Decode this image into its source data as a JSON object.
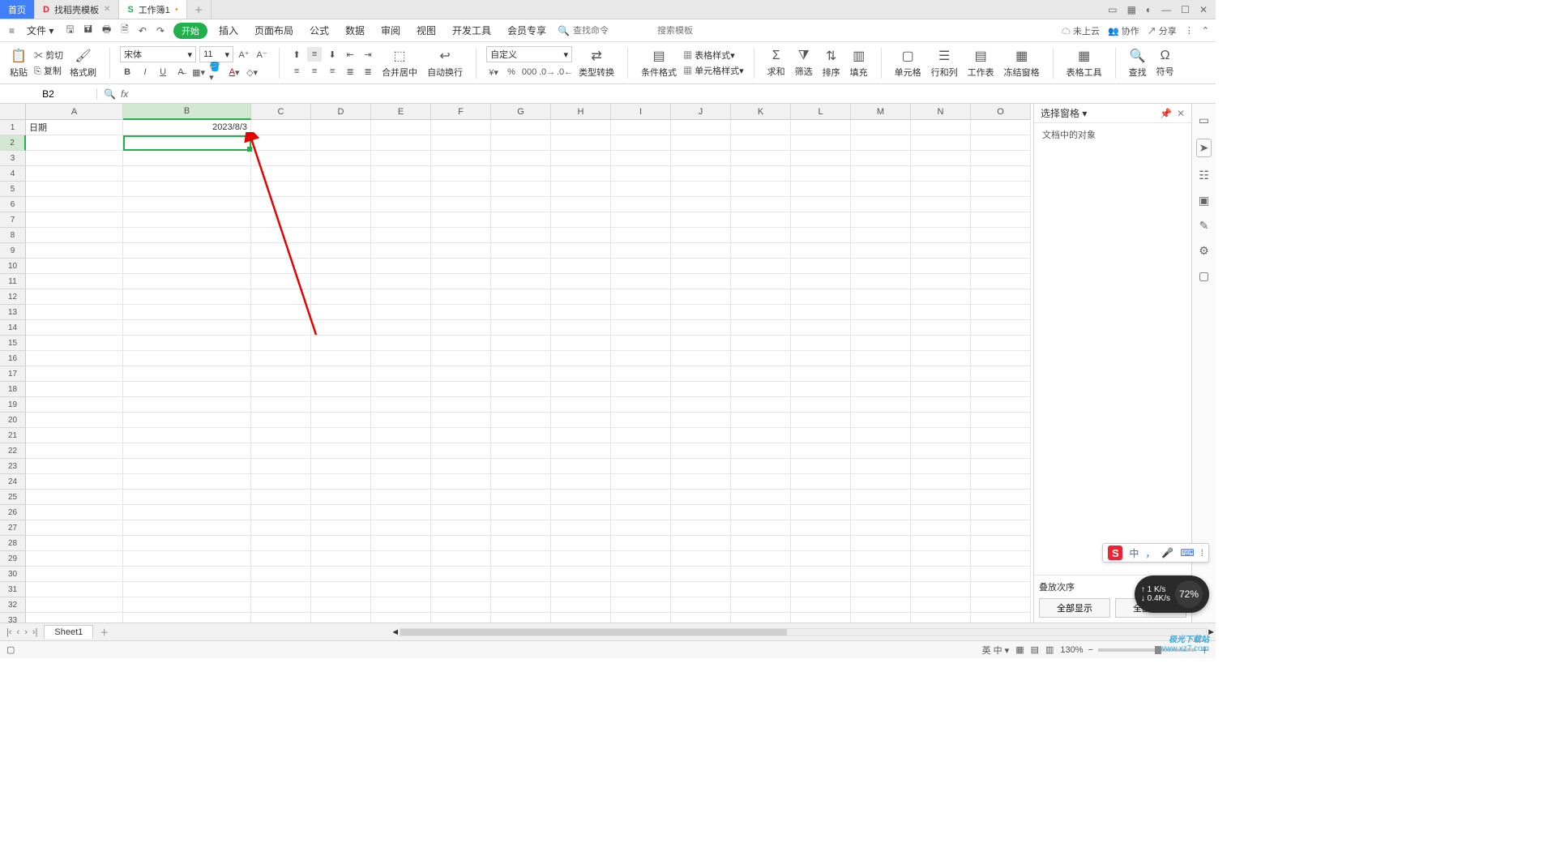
{
  "title": {
    "home": "首页",
    "template_tab": "找稻壳模板",
    "workbook": "工作簿1"
  },
  "menu": {
    "file": "文件",
    "start": "开始",
    "insert": "插入",
    "layout": "页面布局",
    "formula": "公式",
    "data": "数据",
    "review": "审阅",
    "view": "视图",
    "dev": "开发工具",
    "member": "会员专享",
    "search_cmd_placeholder": "查找命令",
    "search_tpl_placeholder": "搜索模板",
    "cloud": "未上云",
    "collab": "协作",
    "share": "分享"
  },
  "ribbon": {
    "paste": "粘贴",
    "cut": "剪切",
    "copy": "复制",
    "format_painter": "格式刷",
    "font_name": "宋体",
    "font_size": "11",
    "merge_center": "合并居中",
    "auto_wrap": "自动换行",
    "number_format": "自定义",
    "type_convert": "类型转换",
    "cond_fmt": "条件格式",
    "table_style": "表格样式",
    "cell_style": "单元格样式",
    "sum": "求和",
    "filter": "筛选",
    "sort": "排序",
    "fill": "填充",
    "cell": "单元格",
    "row_col": "行和列",
    "worksheet": "工作表",
    "freeze": "冻结窗格",
    "tools": "表格工具",
    "find": "查找",
    "symbol": "符号"
  },
  "address": {
    "cell_ref": "B2",
    "formula": ""
  },
  "columns": [
    "A",
    "B",
    "C",
    "D",
    "E",
    "F",
    "G",
    "H",
    "I",
    "J",
    "K",
    "L",
    "M",
    "N",
    "O"
  ],
  "col_width_A": 120,
  "col_width_B": 158,
  "cells": {
    "A1": "日期",
    "B1": "2023/8/3"
  },
  "row_count": 34,
  "taskpane": {
    "title": "选择窗格",
    "sub": "文档中的对象",
    "z_order": "叠放次序",
    "show_all": "全部显示",
    "hide_all": "全部隐藏"
  },
  "sheet_tabs": {
    "sheet1": "Sheet1"
  },
  "status": {
    "zoom": "130%"
  },
  "ime": {
    "lang": "中"
  },
  "speed": {
    "up": "1 K/s",
    "down": "0.4K/s",
    "pct": "72%"
  },
  "watermark": {
    "name": "极光下载站",
    "url": "www.xz7.com"
  }
}
